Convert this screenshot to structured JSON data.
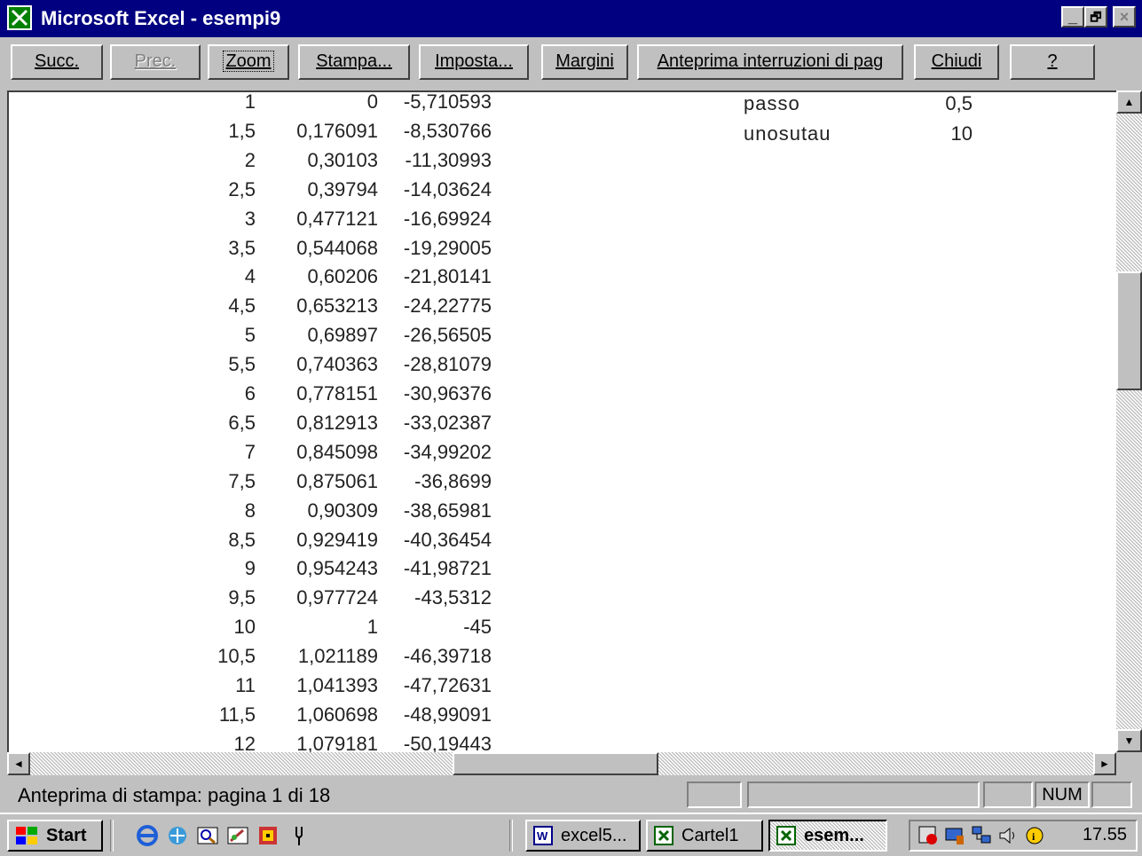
{
  "window": {
    "title": "Microsoft Excel - esempi9",
    "minimize": "_",
    "maximize": "🗗",
    "close": "×"
  },
  "toolbar": {
    "next": "Succ.",
    "prev": "Prec.",
    "zoom": "Zoom",
    "print": "Stampa...",
    "setup": "Imposta...",
    "margins": "Margini",
    "page_break_preview": "Anteprima interruzioni di pag",
    "close": "Chiudi",
    "help": "?"
  },
  "sheet": {
    "rows": [
      [
        "1",
        "0",
        "-5,710593"
      ],
      [
        "1,5",
        "0,176091",
        "-8,530766"
      ],
      [
        "2",
        "0,30103",
        "-11,30993"
      ],
      [
        "2,5",
        "0,39794",
        "-14,03624"
      ],
      [
        "3",
        "0,477121",
        "-16,69924"
      ],
      [
        "3,5",
        "0,544068",
        "-19,29005"
      ],
      [
        "4",
        "0,60206",
        "-21,80141"
      ],
      [
        "4,5",
        "0,653213",
        "-24,22775"
      ],
      [
        "5",
        "0,69897",
        "-26,56505"
      ],
      [
        "5,5",
        "0,740363",
        "-28,81079"
      ],
      [
        "6",
        "0,778151",
        "-30,96376"
      ],
      [
        "6,5",
        "0,812913",
        "-33,02387"
      ],
      [
        "7",
        "0,845098",
        "-34,99202"
      ],
      [
        "7,5",
        "0,875061",
        "-36,8699"
      ],
      [
        "8",
        "0,90309",
        "-38,65981"
      ],
      [
        "8,5",
        "0,929419",
        "-40,36454"
      ],
      [
        "9",
        "0,954243",
        "-41,98721"
      ],
      [
        "9,5",
        "0,977724",
        "-43,5312"
      ],
      [
        "10",
        "1",
        "-45"
      ],
      [
        "10,5",
        "1,021189",
        "-46,39718"
      ],
      [
        "11",
        "1,041393",
        "-47,72631"
      ],
      [
        "11,5",
        "1,060698",
        "-48,99091"
      ],
      [
        "12",
        "1,079181",
        "-50,19443"
      ]
    ],
    "params": [
      {
        "label": "passo",
        "value": "0,5"
      },
      {
        "label": "unosutau",
        "value": "10"
      }
    ]
  },
  "statusbar": {
    "text": "Anteprima di stampa: pagina 1 di 18",
    "num": "NUM"
  },
  "taskbar": {
    "start": "Start",
    "tasks": [
      "excel5...",
      "Cartel1",
      "esem..."
    ],
    "clock": "17.55"
  }
}
